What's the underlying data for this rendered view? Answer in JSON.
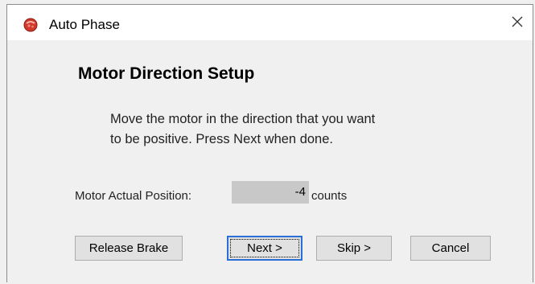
{
  "window": {
    "title": "Auto Phase",
    "close_label": "×"
  },
  "heading": "Motor Direction Setup",
  "instructions": {
    "line1": "Move the motor in the direction that you want",
    "line2": "to be positive.  Press Next when done."
  },
  "position": {
    "label": "Motor Actual Position:",
    "value": "-4",
    "unit": "counts"
  },
  "buttons": {
    "release_brake": "Release Brake",
    "next": "Next >",
    "skip": "Skip >",
    "cancel": "Cancel"
  },
  "colors": {
    "accent": "#2a6fd6",
    "app_icon": "#d03a2c",
    "value_field": "#c8c8c8"
  },
  "icons": {
    "app": "app-logo-icon",
    "close": "close-icon"
  }
}
